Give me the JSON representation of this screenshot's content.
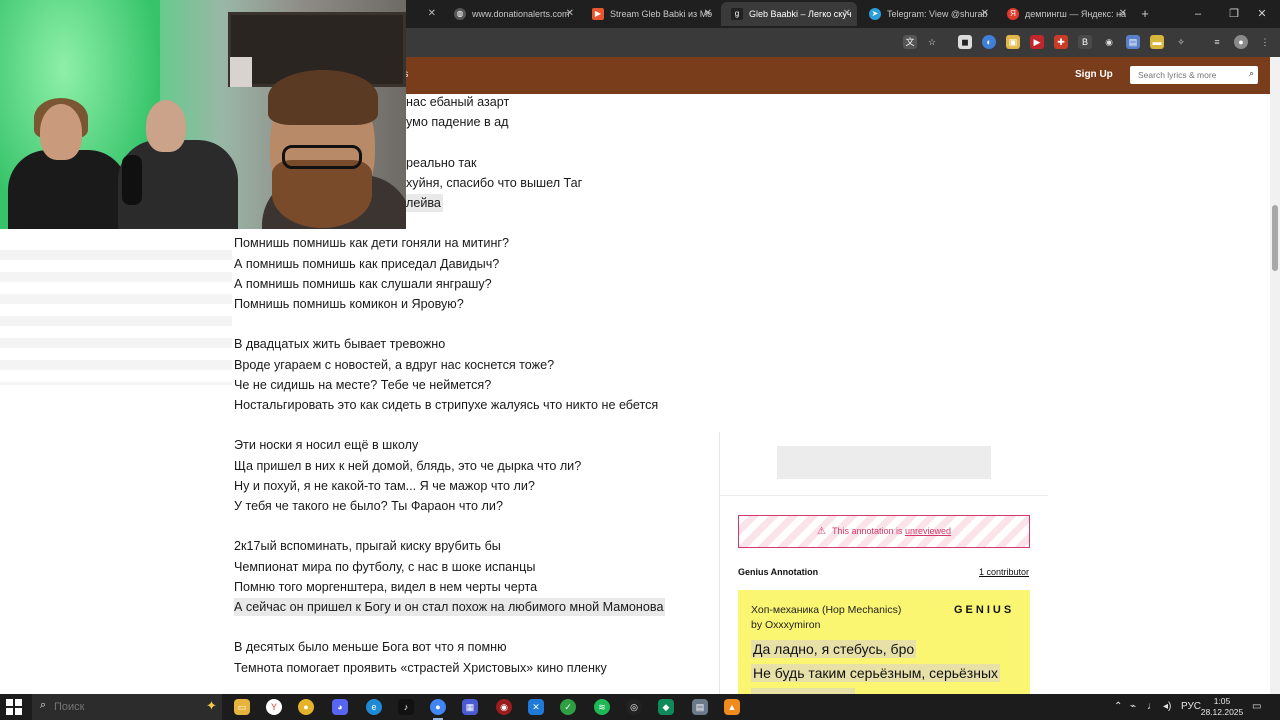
{
  "browser": {
    "tabs": [
      {
        "label": "",
        "active": false
      },
      {
        "label": "www.donationalerts.com",
        "active": false
      },
      {
        "label": "Stream Gleb Babki из Mo",
        "active": false
      },
      {
        "label": "Gleb Baabki – Легко скуч",
        "active": true
      },
      {
        "label": "Telegram: View @shurab",
        "active": false
      },
      {
        "label": "демпингш — Яндекс: на",
        "active": false
      }
    ],
    "new_tab": "+",
    "window_controls": {
      "minimize": "–",
      "maximize": "❐",
      "close": "✕"
    }
  },
  "genius": {
    "nav_fragment": "nts",
    "sign_up": "Sign Up",
    "search_placeholder": "Search lyrics & more"
  },
  "lyrics": [
    {
      "text": "нас ебаный азарт",
      "lead": true,
      "hl": false
    },
    {
      "text": "умо падение в ад",
      "lead": true,
      "hl": false
    },
    {
      "text": "",
      "lead": false,
      "hl": false
    },
    {
      "text": "реально так",
      "lead": true,
      "hl": false
    },
    {
      "text": "хуйня, спасибо что вышел Таг",
      "lead": true,
      "hl": false
    },
    {
      "text": "лейва",
      "lead": true,
      "hl": true
    },
    {
      "text": "",
      "lead": false,
      "hl": false
    },
    {
      "text": "Помнишь помнишь как дети гоняли на митинг?",
      "lead": false,
      "hl": false
    },
    {
      "text": "А помнишь помнишь как приседал Давидыч?",
      "lead": false,
      "hl": false
    },
    {
      "text": "А помнишь помнишь как слушали янграшу?",
      "lead": false,
      "hl": false
    },
    {
      "text": "Помнишь помнишь комикон и Яровую?",
      "lead": false,
      "hl": false
    },
    {
      "text": "",
      "lead": false,
      "hl": false
    },
    {
      "text": "В двадцатых жить бывает тревожно",
      "lead": false,
      "hl": false
    },
    {
      "text": "Вроде угараем с новостей, а вдруг нас коснется тоже?",
      "lead": false,
      "hl": false
    },
    {
      "text": "Че не сидишь на месте? Тебе че неймется?",
      "lead": false,
      "hl": false
    },
    {
      "text": "Ностальгировать это как сидеть в стрипухе жалуясь что никто не ебется",
      "lead": false,
      "hl": false
    },
    {
      "text": "",
      "lead": false,
      "hl": false
    },
    {
      "text": "Эти носки я носил ещё в школу",
      "lead": false,
      "hl": false
    },
    {
      "text": "Ща пришел в них к ней домой, блядь, это че дырка что ли?",
      "lead": false,
      "hl": false
    },
    {
      "text": "Ну и похуй, я не какой-то там... Я че мажор что ли?",
      "lead": false,
      "hl": false
    },
    {
      "text": "У тебя че такого не было? Ты Фараон что ли?",
      "lead": false,
      "hl": false
    },
    {
      "text": "",
      "lead": false,
      "hl": false
    },
    {
      "text": "2к17ый вспоминать, прыгай киску врубить бы",
      "lead": false,
      "hl": false
    },
    {
      "text": "Чемпионат мира по футболу, с нас в шоке испанцы",
      "lead": false,
      "hl": false
    },
    {
      "text": "Помню того моргенштера, видел в нем черты черта",
      "lead": false,
      "hl": false
    },
    {
      "text": "А сейчас он пришел к Богу и он стал похож на любимого мной Мамонова",
      "lead": false,
      "hl": true
    },
    {
      "text": "",
      "lead": false,
      "hl": false
    },
    {
      "text": "В десятых было меньше Бога вот что я помню",
      "lead": false,
      "hl": false
    },
    {
      "text": "Темнота помогает проявить «страстей Христовых» кино пленку",
      "lead": false,
      "hl": false
    }
  ],
  "annotation": {
    "unreviewed_prefix": "This annotation is",
    "unreviewed_link": "unreviewed",
    "title": "Genius Annotation",
    "contributors": "1 contributor",
    "song": "Хоп-механика (Hop Mechanics)",
    "by": "by Oxxxymiron",
    "logo": "GENIUS",
    "quote_lines": [
      "Да ладно, я стебусь, бро",
      "Не будь таким серьёзным, серьёзных"
    ]
  },
  "taskbar": {
    "search_placeholder": "Поиск",
    "lang": "РУС",
    "time": "1:05",
    "date": "28.12.2025"
  },
  "colors": {
    "genius_header": "#7a3d1c",
    "annotation_card": "#fbf672",
    "unreviewed": "#d6376a"
  }
}
